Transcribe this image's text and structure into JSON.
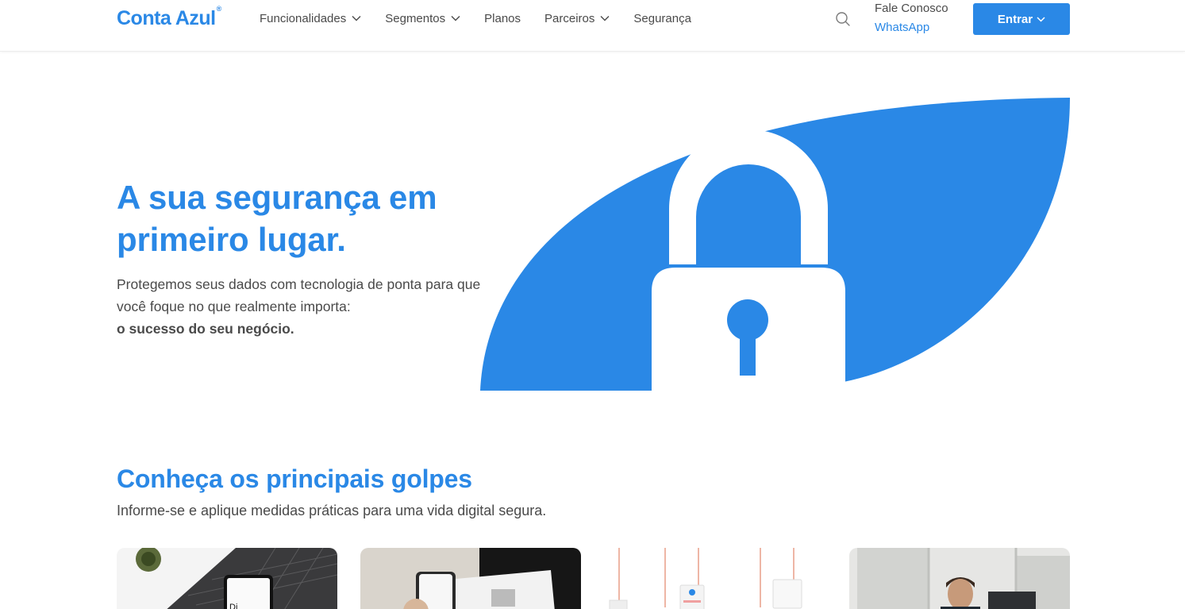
{
  "brand": {
    "name": "Conta Azul",
    "mark": "®"
  },
  "nav": {
    "items": [
      {
        "label": "Funcionalidades",
        "has_dropdown": true
      },
      {
        "label": "Segmentos",
        "has_dropdown": true
      },
      {
        "label": "Planos",
        "has_dropdown": false
      },
      {
        "label": "Parceiros",
        "has_dropdown": true
      },
      {
        "label": "Segurança",
        "has_dropdown": false
      }
    ],
    "search_icon": "search-icon",
    "contact_label": "Fale Conosco",
    "contact_link": "WhatsApp",
    "login_label": "Entrar"
  },
  "hero": {
    "title": "A sua segurança em primeiro lugar.",
    "description": "Protegemos seus dados com tecnologia de ponta para que você foque no que realmente importa:",
    "description_strong": "o sucesso do seu negócio.",
    "graphic_icon": "lock-icon"
  },
  "section": {
    "title": "Conheça os principais golpes",
    "subtitle": "Informe-se e aplique medidas práticas para uma vida digital segura."
  },
  "cards": [
    {
      "icon": "laptop-phone-photo"
    },
    {
      "icon": "phone-document-photo"
    },
    {
      "icon": "phishing-hooks-photo"
    },
    {
      "icon": "office-person-photo"
    }
  ],
  "colors": {
    "accent": "#2a88e6",
    "text": "#4a4a4a",
    "background": "#ffffff"
  }
}
